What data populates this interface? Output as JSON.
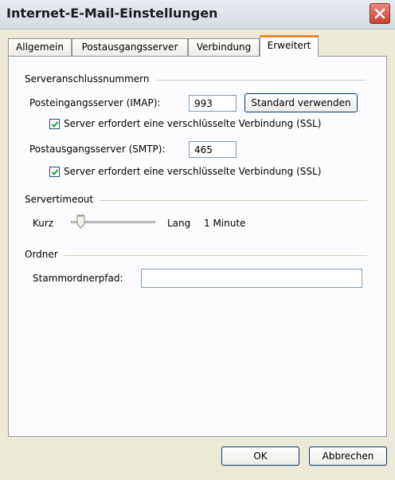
{
  "window": {
    "title": "Internet-E-Mail-Einstellungen"
  },
  "tabs": [
    {
      "label": "Allgemein",
      "active": false
    },
    {
      "label": "Postausgangsserver",
      "active": false
    },
    {
      "label": "Verbindung",
      "active": false
    },
    {
      "label": "Erweitert",
      "active": true
    }
  ],
  "server_ports": {
    "group_label": "Serveranschlussnummern",
    "incoming_label": "Posteingangsserver (IMAP):",
    "incoming_value": "993",
    "default_button": "Standard verwenden",
    "incoming_ssl_label": "Server erfordert eine verschlüsselte Verbindung (SSL)",
    "incoming_ssl_checked": true,
    "outgoing_label": "Postausgangsserver (SMTP):",
    "outgoing_value": "465",
    "outgoing_ssl_label": "Server erfordert eine verschlüsselte Verbindung (SSL)",
    "outgoing_ssl_checked": true
  },
  "timeout": {
    "group_label": "Servertimeout",
    "short_label": "Kurz",
    "long_label": "Lang",
    "value_text": "1 Minute",
    "slider_level": 0.1
  },
  "folders": {
    "group_label": "Ordner",
    "root_path_label": "Stammordnerpfad:",
    "root_path_value": ""
  },
  "footer": {
    "ok_label": "OK",
    "cancel_label": "Abbrechen"
  },
  "colors": {
    "active_tab_accent": "#e68b2c",
    "close_button": "#c9412e",
    "checkmark": "#21a121"
  }
}
